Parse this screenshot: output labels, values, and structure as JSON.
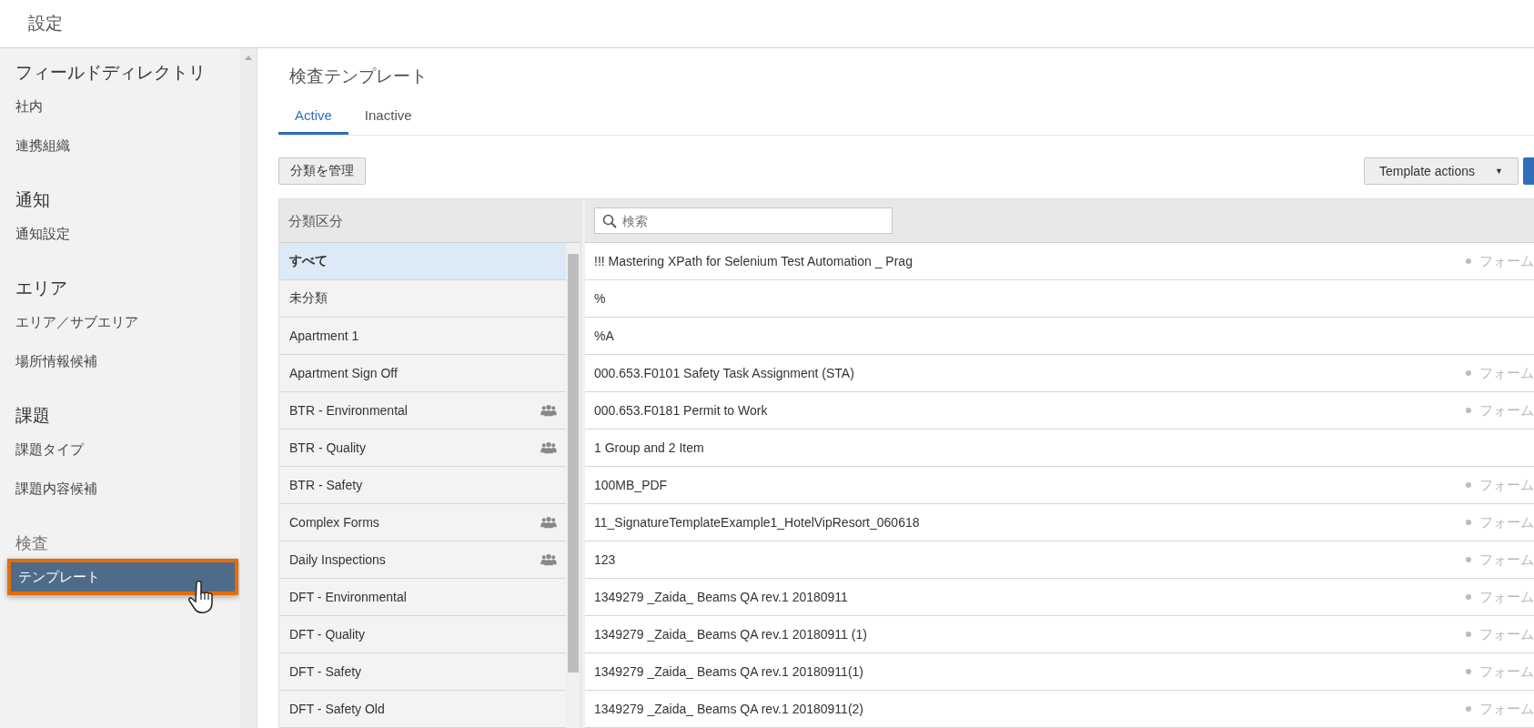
{
  "header": {
    "title": "設定"
  },
  "sidebar": {
    "sections": [
      {
        "title": "フィールドディレクトリ",
        "muted": false,
        "items": [
          {
            "label": "社内",
            "selected": false
          },
          {
            "label": "連携組織",
            "selected": false
          }
        ]
      },
      {
        "title": "通知",
        "muted": false,
        "items": [
          {
            "label": "通知設定",
            "selected": false
          }
        ]
      },
      {
        "title": "エリア",
        "muted": false,
        "items": [
          {
            "label": "エリア／サブエリア",
            "selected": false
          },
          {
            "label": "場所情報候補",
            "selected": false
          }
        ]
      },
      {
        "title": "課題",
        "muted": false,
        "items": [
          {
            "label": "課題タイプ",
            "selected": false
          },
          {
            "label": "課題内容候補",
            "selected": false
          }
        ]
      },
      {
        "title": "検査",
        "muted": true,
        "items": [
          {
            "label": "テンプレート",
            "selected": true
          }
        ]
      }
    ]
  },
  "page": {
    "title": "検査テンプレート"
  },
  "tabs": [
    {
      "label": "Active",
      "selected": true
    },
    {
      "label": "Inactive",
      "selected": false
    }
  ],
  "toolbar": {
    "manage_button": "分類を管理",
    "actions_button": "Template actions",
    "actions_caret": "▼"
  },
  "categories": {
    "heading": "分類区分",
    "items": [
      {
        "label": "すべて",
        "selected": true,
        "shared": false
      },
      {
        "label": "未分類",
        "selected": false,
        "shared": false
      },
      {
        "label": "Apartment 1",
        "selected": false,
        "shared": false
      },
      {
        "label": "Apartment Sign Off",
        "selected": false,
        "shared": false
      },
      {
        "label": "BTR - Environmental",
        "selected": false,
        "shared": true
      },
      {
        "label": "BTR - Quality",
        "selected": false,
        "shared": true
      },
      {
        "label": "BTR - Safety",
        "selected": false,
        "shared": false
      },
      {
        "label": "Complex Forms",
        "selected": false,
        "shared": true
      },
      {
        "label": "Daily Inspections",
        "selected": false,
        "shared": true
      },
      {
        "label": "DFT - Environmental",
        "selected": false,
        "shared": false
      },
      {
        "label": "DFT - Quality",
        "selected": false,
        "shared": false
      },
      {
        "label": "DFT - Safety",
        "selected": false,
        "shared": false
      },
      {
        "label": "DFT - Safety Old",
        "selected": false,
        "shared": false
      }
    ]
  },
  "templates": {
    "search": {
      "placeholder": "検索"
    },
    "rows": [
      {
        "name": "!!! Mastering XPath for Selenium Test Automation _ Prag",
        "status": "フォーム"
      },
      {
        "name": "%",
        "status": null
      },
      {
        "name": "%A",
        "status": null
      },
      {
        "name": "000.653.F0101 Safety Task Assignment (STA)",
        "status": "フォーム"
      },
      {
        "name": "000.653.F0181 Permit to Work",
        "status": "フォーム"
      },
      {
        "name": "1 Group and 2 Item",
        "status": null
      },
      {
        "name": "100MB_PDF",
        "status": "フォーム"
      },
      {
        "name": "11_SignatureTemplateExample1_HotelVipResort_060618",
        "status": "フォーム"
      },
      {
        "name": "123",
        "status": "フォーム"
      },
      {
        "name": "1349279 _Zaida_ Beams QA rev.1 20180911",
        "status": "フォーム"
      },
      {
        "name": "1349279 _Zaida_ Beams QA rev.1 20180911 (1)",
        "status": "フォーム"
      },
      {
        "name": "1349279 _Zaida_ Beams QA rev.1 20180911(1)",
        "status": "フォーム"
      },
      {
        "name": "1349279 _Zaida_ Beams QA rev.1 20180911(2)",
        "status": "フォーム"
      }
    ]
  }
}
